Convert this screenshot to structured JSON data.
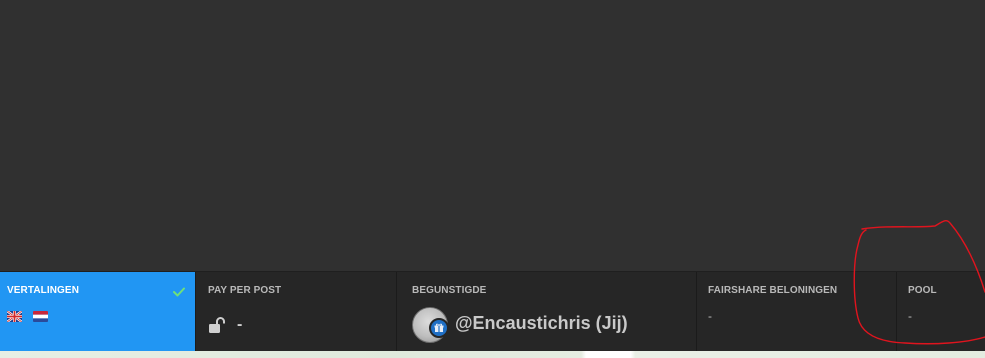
{
  "panels": {
    "translations": {
      "label": "VERTALINGEN",
      "flags": [
        "uk-flag",
        "nl-flag"
      ],
      "selected_color": "#2196f3",
      "check_color": "#6ee07a"
    },
    "pay_per_post": {
      "label": "PAY PER POST",
      "value": "-"
    },
    "beneficiary": {
      "label": "BEGUNSTIGDE",
      "name": "@Encaustichris (Jij)",
      "badge_color": "#1f6fc5"
    },
    "fairshare": {
      "label": "FAIRSHARE BELONINGEN",
      "value": "-"
    },
    "pool": {
      "label": "POOL",
      "value": "-"
    }
  },
  "annotation": {
    "color": "#e0141e"
  }
}
